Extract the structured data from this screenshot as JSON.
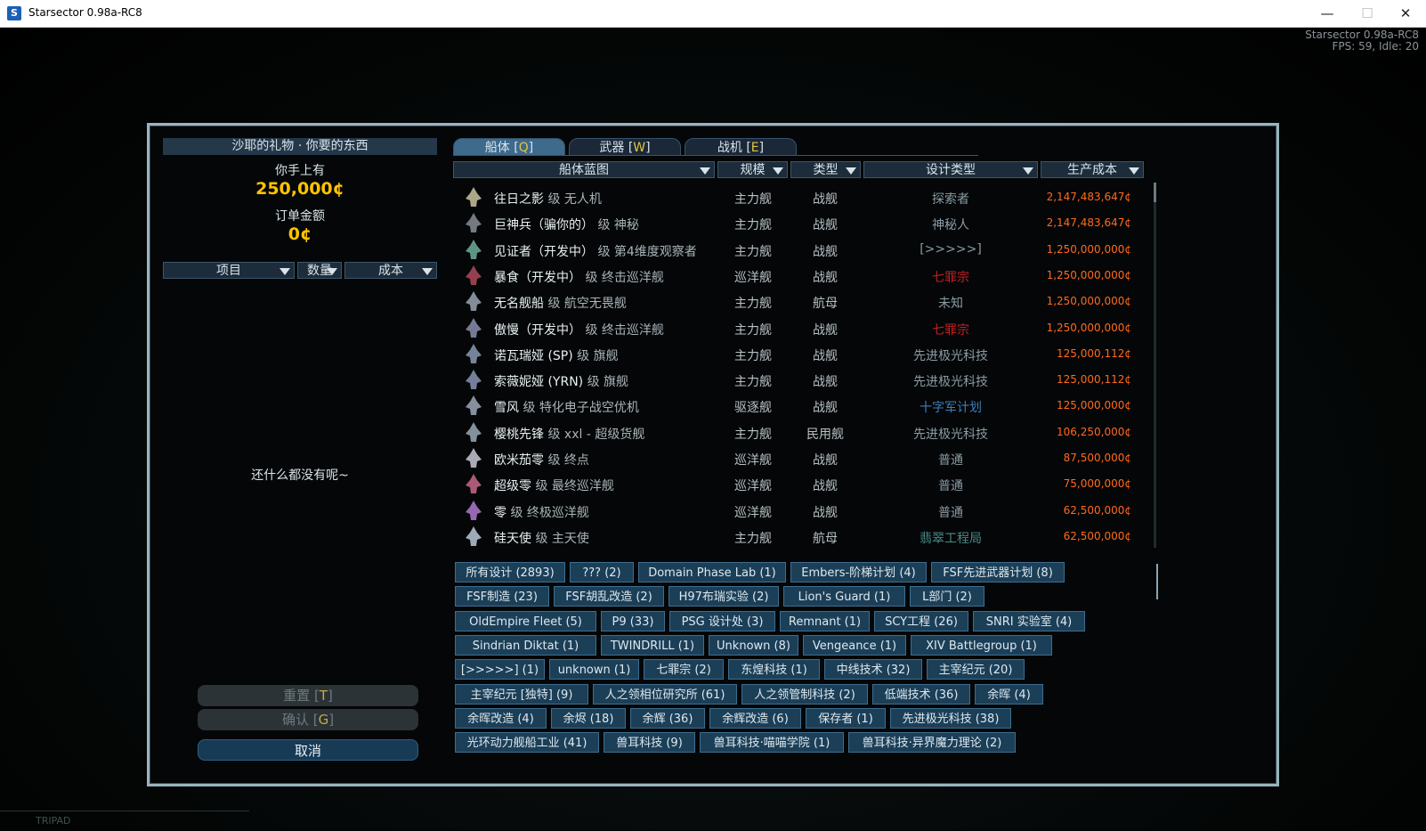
{
  "window": {
    "title": "Starsector 0.98a-RC8",
    "minimize": "—",
    "maximize": "☐",
    "close": "✕"
  },
  "overlay": {
    "fps": "Starsector 0.98a-RC8",
    "fps_line": "FPS: 59, Idle: 20"
  },
  "background": {
    "tripad": "TRIPAD"
  },
  "left": {
    "title": "沙耶的礼物 · 你要的东西",
    "funds_label": "你手上有",
    "funds_value": "250,000¢",
    "order_label": "订单金额",
    "order_value": "0¢",
    "col_item": "项目",
    "col_qty": "数量",
    "col_cost": "成本",
    "empty": "还什么都没有呢~",
    "reset_label": "重置",
    "reset_key": "T",
    "confirm_label": "确认",
    "confirm_key": "G",
    "cancel_label": "取消"
  },
  "tabs": [
    {
      "label": "船体",
      "key": "Q"
    },
    {
      "label": "武器",
      "key": "W"
    },
    {
      "label": "战机",
      "key": "E"
    }
  ],
  "table": {
    "headers": {
      "blueprint": "船体蓝图",
      "size": "规模",
      "type": "类型",
      "design": "设计类型",
      "cost": "生产成本"
    },
    "rows": [
      {
        "name": "往日之影",
        "cls": "级 无人机",
        "size": "主力舰",
        "type": "战舰",
        "design": "探索者",
        "design_color": "#8a9ca6",
        "cost": "2,147,483,647¢"
      },
      {
        "name": "巨神兵（骗你的）",
        "cls": "级 神秘",
        "size": "主力舰",
        "type": "战舰",
        "design": "神秘人",
        "design_color": "#8a9ca6",
        "cost": "2,147,483,647¢"
      },
      {
        "name": "见证者（开发中）",
        "cls": "级 第4维度观察者",
        "size": "主力舰",
        "type": "战舰",
        "design": "[>>>>>]",
        "design_color": "#8a9ca6",
        "cost": "1,250,000,000¢"
      },
      {
        "name": "暴食（开发中）",
        "cls": "级 终击巡洋舰",
        "size": "巡洋舰",
        "type": "战舰",
        "design": "七罪宗",
        "design_color": "#c42020",
        "cost": "1,250,000,000¢"
      },
      {
        "name": "无名舰船",
        "cls": "级 航空无畏舰",
        "size": "主力舰",
        "type": "航母",
        "design": "未知",
        "design_color": "#8a9ca6",
        "cost": "1,250,000,000¢"
      },
      {
        "name": "傲慢（开发中）",
        "cls": "级 终击巡洋舰",
        "size": "主力舰",
        "type": "战舰",
        "design": "七罪宗",
        "design_color": "#c42020",
        "cost": "1,250,000,000¢"
      },
      {
        "name": "诺瓦瑞娅 (SP)",
        "cls": "级 旗舰",
        "size": "主力舰",
        "type": "战舰",
        "design": "先进极光科技",
        "design_color": "#8a9ca6",
        "cost": "125,000,112¢"
      },
      {
        "name": "索薇妮娅 (YRN)",
        "cls": "级 旗舰",
        "size": "主力舰",
        "type": "战舰",
        "design": "先进极光科技",
        "design_color": "#8a9ca6",
        "cost": "125,000,112¢"
      },
      {
        "name": "雪风",
        "cls": "级 特化电子战空优机",
        "size": "驱逐舰",
        "type": "战舰",
        "design": "十字军计划",
        "design_color": "#3d7fb8",
        "cost": "125,000,000¢"
      },
      {
        "name": "樱桃先锋",
        "cls": "级 xxl - 超级货舰",
        "size": "主力舰",
        "type": "民用舰",
        "design": "先进极光科技",
        "design_color": "#8a9ca6",
        "cost": "106,250,000¢"
      },
      {
        "name": "欧米茄零",
        "cls": "级 终点",
        "size": "巡洋舰",
        "type": "战舰",
        "design": "普通",
        "design_color": "#8a9ca6",
        "cost": "87,500,000¢"
      },
      {
        "name": "超级零",
        "cls": "级 最终巡洋舰",
        "size": "巡洋舰",
        "type": "战舰",
        "design": "普通",
        "design_color": "#8a9ca6",
        "cost": "75,000,000¢"
      },
      {
        "name": "零",
        "cls": "级 终极巡洋舰",
        "size": "巡洋舰",
        "type": "战舰",
        "design": "普通",
        "design_color": "#8a9ca6",
        "cost": "62,500,000¢"
      },
      {
        "name": "硅天使",
        "cls": "级 主天使",
        "size": "主力舰",
        "type": "航母",
        "design": "翡翠工程局",
        "design_color": "#4c8a8a",
        "cost": "62,500,000¢"
      }
    ]
  },
  "filters": [
    [
      "所有设计 (2893)",
      "??? (2)",
      "Domain Phase Lab (1)",
      "Embers-阶梯计划 (4)",
      "FSF先进武器计划 (8)"
    ],
    [
      "FSF制造 (23)",
      "FSF胡乱改造 (2)",
      "H97布瑞实验 (2)",
      "Lion's Guard (1)",
      "L部门 (2)"
    ],
    [
      "OldEmpire Fleet (5)",
      "P9 (33)",
      "PSG 设计处 (3)",
      "Remnant (1)",
      "SCY工程 (26)",
      "SNRI 实验室 (4)"
    ],
    [
      "Sindrian Diktat (1)",
      "TWINDRILL (1)",
      "Unknown (8)",
      "Vengeance (1)",
      "XIV Battlegroup (1)"
    ],
    [
      "[>>>>>] (1)",
      "unknown (1)",
      "七罪宗 (2)",
      "东煌科技 (1)",
      "中线技术 (32)",
      "主宰纪元 (20)"
    ],
    [
      "主宰纪元 [独特] (9)",
      "人之领相位研究所 (61)",
      "人之领管制科技 (2)",
      "低端技术 (36)",
      "余晖 (4)"
    ],
    [
      "余晖改造 (4)",
      "余烬 (18)",
      "余辉 (36)",
      "余辉改造 (6)",
      "保存者 (1)",
      "先进极光科技 (38)"
    ],
    [
      "光环动力舰船工业 (41)",
      "兽耳科技 (9)",
      "兽耳科技·喵喵学院 (1)",
      "兽耳科技·异界魔力理论 (2)"
    ]
  ]
}
